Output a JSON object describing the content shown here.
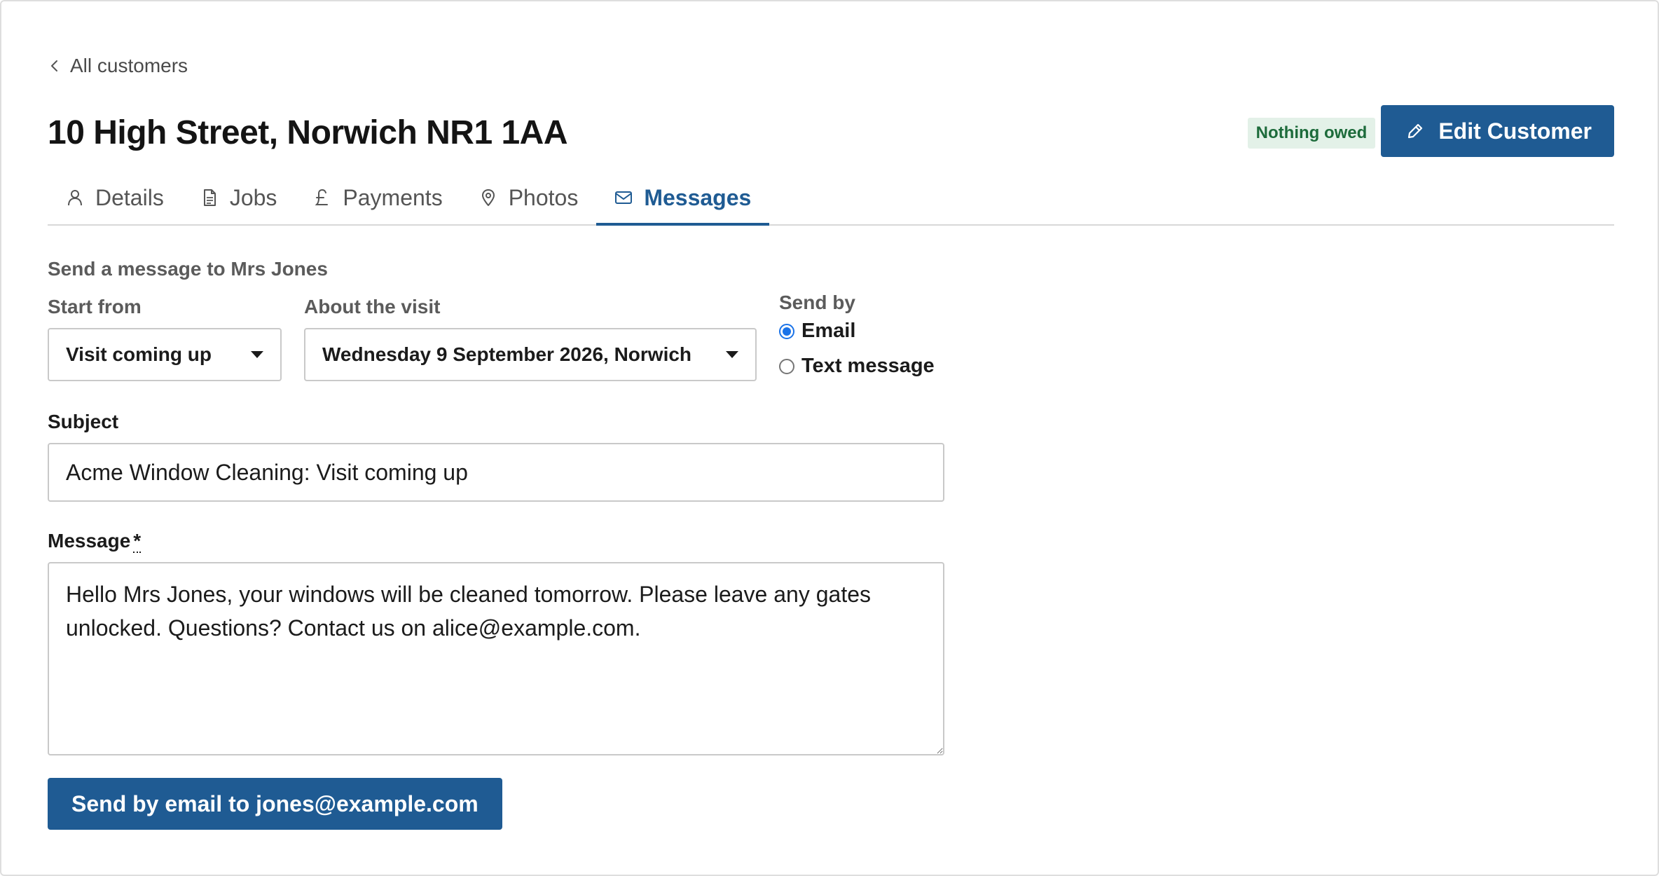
{
  "breadcrumb": {
    "label": "All customers"
  },
  "header": {
    "title": "10 High Street, Norwich NR1 1AA",
    "status_badge": "Nothing owed",
    "edit_button": "Edit Customer"
  },
  "tabs": [
    {
      "label": "Details",
      "icon": "person-icon",
      "active": false
    },
    {
      "label": "Jobs",
      "icon": "document-icon",
      "active": false
    },
    {
      "label": "Payments",
      "icon": "pound-icon",
      "active": false
    },
    {
      "label": "Photos",
      "icon": "map-pin-icon",
      "active": false
    },
    {
      "label": "Messages",
      "icon": "envelope-icon",
      "active": true
    }
  ],
  "form": {
    "heading": "Send a message to Mrs Jones",
    "start_from": {
      "label": "Start from",
      "value": "Visit coming up"
    },
    "about_visit": {
      "label": "About the visit",
      "value": "Wednesday 9 September 2026, Norwich"
    },
    "send_by": {
      "label": "Send by",
      "options": [
        {
          "label": "Email",
          "checked": true
        },
        {
          "label": "Text message",
          "checked": false
        }
      ]
    },
    "subject": {
      "label": "Subject",
      "value": "Acme Window Cleaning: Visit coming up"
    },
    "message": {
      "label": "Message",
      "required_mark": "*",
      "value": "Hello Mrs Jones, your windows will be cleaned tomorrow. Please leave any gates unlocked. Questions? Contact us on alice@example.com."
    },
    "send_button": "Send by email to jones@example.com"
  },
  "colors": {
    "primary": "#1f5b93",
    "badge_bg": "#e3f1e8",
    "badge_text": "#1d6b3b",
    "radio_checked": "#1a73e8"
  }
}
